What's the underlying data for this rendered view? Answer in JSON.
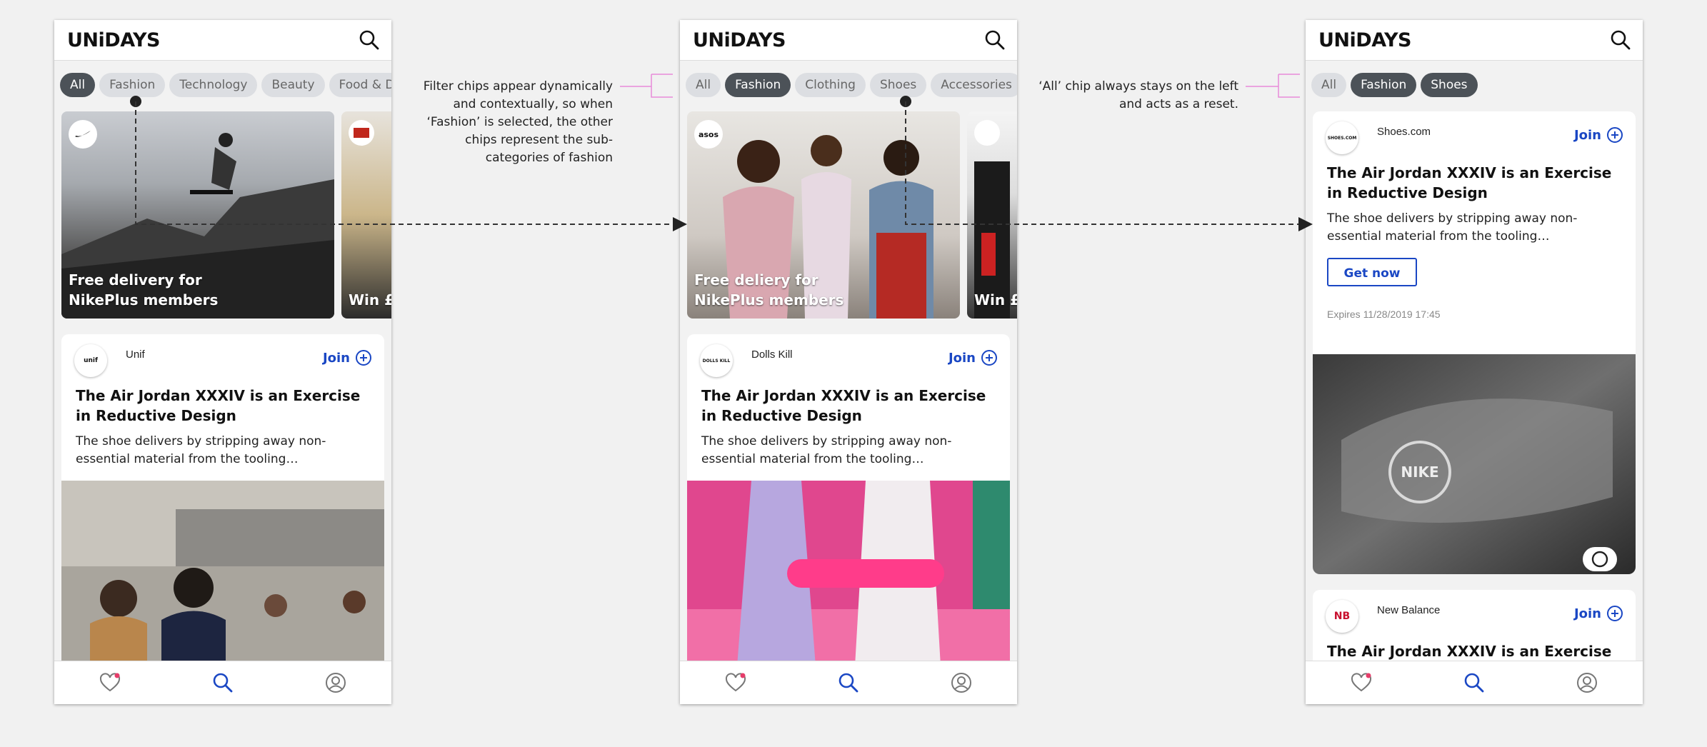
{
  "brand": "UNiDAYS",
  "screens": [
    {
      "chips": [
        "All",
        "Fashion",
        "Technology",
        "Beauty",
        "Food & D"
      ],
      "selected_chip": "All",
      "heroes": [
        {
          "title": "Free delivery for NikePlus members",
          "badge": "nike-swoosh"
        },
        {
          "title": "Win £",
          "badge": "red-logo"
        }
      ],
      "card": {
        "brand": "Unif",
        "logo_text": "unif",
        "join": "Join",
        "title": "The Air Jordan XXXIV is an Exercise in Reductive Design",
        "desc": "The shoe delivers by stripping away non-essential material from the tooling…"
      }
    },
    {
      "chips": [
        "All",
        "Fashion",
        "Clothing",
        "Shoes",
        "Accessories"
      ],
      "selected_chip": "Fashion",
      "heroes": [
        {
          "title": "Free deliery for NikePlus members",
          "badge": "asos"
        },
        {
          "title": "Win £",
          "badge": "logo"
        }
      ],
      "card": {
        "brand": "Dolls Kill",
        "logo_text": "DOLLS KILL",
        "join": "Join",
        "title": "The Air Jordan XXXIV is an Exercise in Reductive Design",
        "desc": "The shoe delivers by stripping away non-essential material from the tooling…"
      }
    },
    {
      "chips": [
        "All",
        "Fashion",
        "Shoes"
      ],
      "selected_chip": "Shoes",
      "card": {
        "brand": "Shoes.com",
        "logo_text": "SHOES.COM",
        "join": "Join",
        "title": "The Air Jordan XXXIV is an Exercise in Reductive Design",
        "desc": "The shoe delivers by stripping away non-essential material from the tooling…",
        "cta": "Get now",
        "expires": "Expires 11/28/2019 17:45"
      },
      "card2": {
        "brand": "New Balance",
        "logo_text": "NB",
        "join": "Join",
        "title": "The Air Jordan XXXIV is an Exercise in"
      }
    }
  ],
  "annotations": [
    "Filter chips appear dynamically and contextually, so when ‘Fashion’ is selected, the other chips represent the sub-categories of fashion",
    "‘All’ chip always stays on the left and acts as a reset."
  ],
  "nav_icons": [
    "heart-icon",
    "search-icon",
    "profile-icon"
  ],
  "colors": {
    "accent": "#1a47c4",
    "chip_selected": "#4c5258",
    "chip": "#dcdee2",
    "annotation_line": "#e88ad9"
  }
}
